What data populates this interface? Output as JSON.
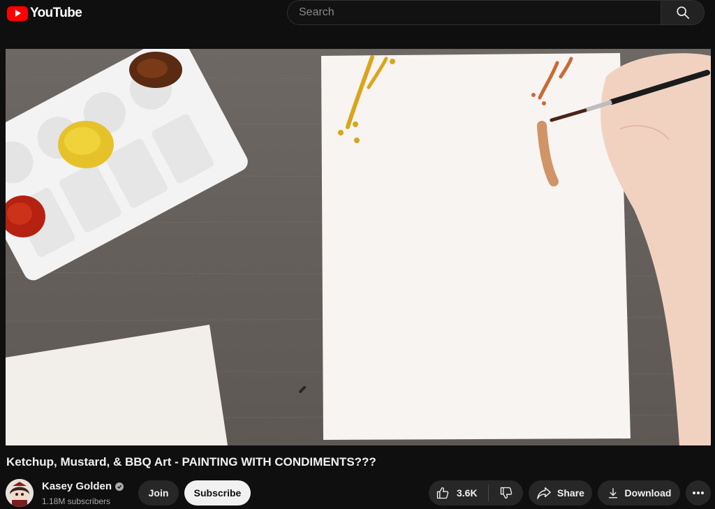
{
  "header": {
    "logo_text": "YouTube",
    "search": {
      "placeholder": "Search",
      "value": ""
    }
  },
  "video": {
    "title": "Ketchup, Mustard, & BBQ Art - PAINTING WITH CONDIMENTS???"
  },
  "channel": {
    "name": "Kasey Golden",
    "verified": true,
    "subscribers": "1.18M subscribers"
  },
  "actions": {
    "join_label": "Join",
    "subscribe_label": "Subscribe",
    "like_count": "3.6K",
    "share_label": "Share",
    "download_label": "Download"
  },
  "icons": {
    "search": "search-icon",
    "like": "thumbs-up-icon",
    "dislike": "thumbs-down-icon",
    "share": "share-arrow-icon",
    "download": "download-icon",
    "more": "more-horizontal-icon",
    "verified": "verified-check-icon"
  },
  "colors": {
    "background": "#0f0f0f",
    "brand_red": "#ff0000",
    "pill_dark": "#272727",
    "subscribe_bg": "#f1f1f1",
    "text_primary": "#f1f1f1",
    "text_secondary": "#aaaaaa"
  }
}
